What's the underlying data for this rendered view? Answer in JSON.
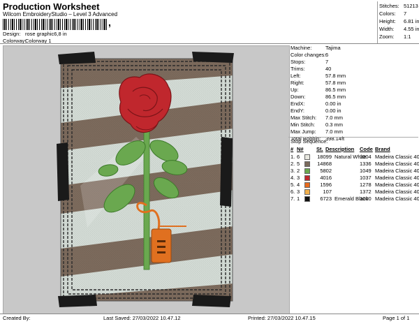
{
  "header": {
    "title": "Production Worksheet",
    "subtitle": "Wilcom EmbroideryStudio – Level 3 Advanced",
    "barcode_suffix": ",",
    "design_label": "Design:",
    "design_value": "rose graphic6,8 in",
    "colorway_label": "Colorway:",
    "colorway_value": "Colorway 1"
  },
  "summary": [
    {
      "label": "Stitches:",
      "value": "51213"
    },
    {
      "label": "Colors:",
      "value": "7"
    },
    {
      "label": "Height:",
      "value": "6.81 in"
    },
    {
      "label": "Width:",
      "value": "4.55 in"
    },
    {
      "label": "Zoom:",
      "value": "1:1"
    }
  ],
  "machine_info": [
    {
      "label": "Machine:",
      "value": "Tajima"
    },
    {
      "label": "Color changes:",
      "value": "6"
    },
    {
      "label": "Stops:",
      "value": "7"
    },
    {
      "label": "Trims:",
      "value": "40"
    },
    {
      "label": "Left:",
      "value": "57.8 mm"
    },
    {
      "label": "Right:",
      "value": "57.8 mm"
    },
    {
      "label": "Up:",
      "value": "86.5 mm"
    },
    {
      "label": "Down:",
      "value": "86.5 mm"
    },
    {
      "label": "EndX:",
      "value": "0.00 in"
    },
    {
      "label": "EndY:",
      "value": "0.00 in"
    },
    {
      "label": "Max Stitch:",
      "value": "7.0 mm"
    },
    {
      "label": "Min Stitch:",
      "value": "0.3 mm"
    },
    {
      "label": "Max Jump:",
      "value": "7.0 mm"
    },
    {
      "label": "Total Bobbin:",
      "value": "398.14ft"
    }
  ],
  "stop_sequence": {
    "title": "Stop Sequence:",
    "headers": {
      "num": "#",
      "n": "N#",
      "st": "St.",
      "desc": "Description",
      "code": "Code",
      "brand": "Brand"
    },
    "rows": [
      {
        "num": "1.",
        "n": "6",
        "color": "#e8e8e0",
        "st": "18099",
        "desc": "Natural White",
        "code": "1004",
        "brand": "Madeira Classic 40"
      },
      {
        "num": "2.",
        "n": "5",
        "color": "#7a6a5c",
        "st": "14868",
        "desc": "",
        "code": "1336",
        "brand": "Madeira Classic 40"
      },
      {
        "num": "3.",
        "n": "2",
        "color": "#6aa84f",
        "st": "5802",
        "desc": "",
        "code": "1049",
        "brand": "Madeira Classic 40"
      },
      {
        "num": "4.",
        "n": "3",
        "color": "#c0272d",
        "st": "4016",
        "desc": "",
        "code": "1037",
        "brand": "Madeira Classic 40"
      },
      {
        "num": "5.",
        "n": "4",
        "color": "#e86a1c",
        "st": "1596",
        "desc": "",
        "code": "1278",
        "brand": "Madeira Classic 40"
      },
      {
        "num": "6.",
        "n": "3",
        "color": "#f2b04c",
        "st": "107",
        "desc": "",
        "code": "1372",
        "brand": "Madeira Classic 40"
      },
      {
        "num": "7.",
        "n": "1",
        "color": "#111111",
        "st": "6723",
        "desc": "Emerald Black",
        "code": "1000",
        "brand": "Madeira Classic 40"
      }
    ]
  },
  "footer": {
    "created": "Created By:",
    "saved": "Last Saved: 27/03/2022 10.47.12",
    "printed": "Printed: 27/03/2022 10.47.15",
    "page": "Page 1 of 1"
  },
  "colors": {
    "preview_bg": "#c8c8c8",
    "stripe_brown": "#7d6b5d",
    "stripe_light": "#d4dcd6",
    "rose_red": "#c0272d",
    "leaf_green": "#6aa84f",
    "tag_orange": "#e07020",
    "corner_black": "#1a1a1a"
  }
}
